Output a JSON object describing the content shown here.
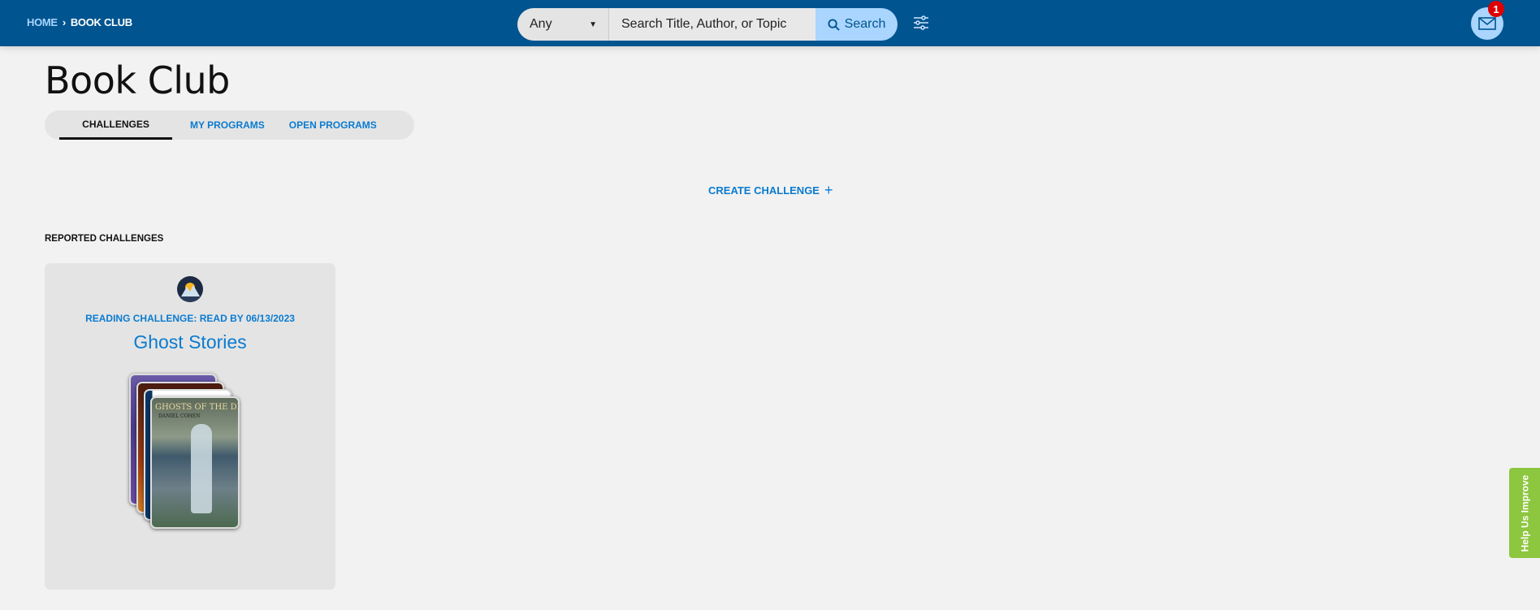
{
  "header": {
    "breadcrumb": {
      "home": "HOME",
      "current": "BOOK CLUB"
    },
    "search": {
      "scope": "Any",
      "placeholder": "Search Title, Author, or Topic",
      "button": "Search"
    },
    "notifications_count": "1"
  },
  "page": {
    "title": "Book Club"
  },
  "tabs": [
    {
      "label": "CHALLENGES",
      "active": true
    },
    {
      "label": "MY PROGRAMS"
    },
    {
      "label": "OPEN PROGRAMS"
    }
  ],
  "create_challenge": "CREATE CHALLENGE",
  "section_title": "REPORTED CHALLENGES",
  "challenge": {
    "type": "READING CHALLENGE: READ BY 06/13/2023",
    "title": "Ghost Stories",
    "front_cover_title": "GHOSTS OF THE DEEP",
    "front_cover_author": "DANIEL COHEN"
  },
  "help_tab": "Help Us Improve",
  "colors": {
    "header": "#00548f",
    "accent": "#0a7bd0",
    "help": "#8dc63f",
    "badge": "#dd0000"
  }
}
